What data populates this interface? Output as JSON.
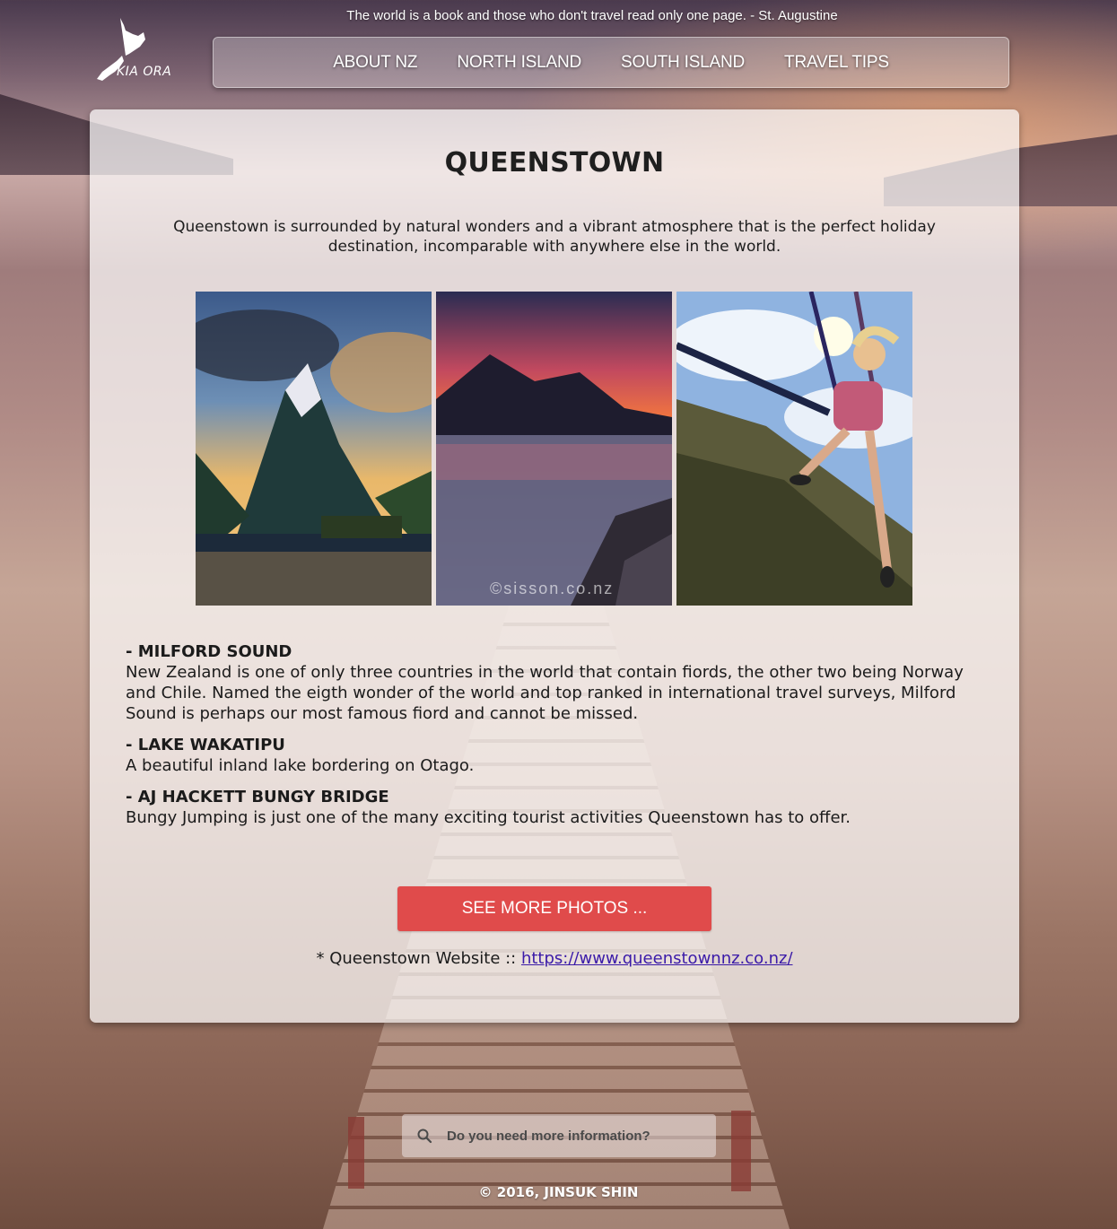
{
  "header": {
    "quote": "The world is a book and those who don't travel read only one page.  - St. Augustine",
    "logo_text": "KIA ORA"
  },
  "nav": {
    "items": [
      {
        "label": "ABOUT NZ"
      },
      {
        "label": "NORTH ISLAND"
      },
      {
        "label": "SOUTH ISLAND"
      },
      {
        "label": "TRAVEL TIPS"
      }
    ]
  },
  "main": {
    "title": "QUEENSTOWN",
    "intro": "Queenstown is surrounded by natural wonders and a vibrant atmosphere that is the perfect holiday destination, incomparable with anywhere else in the world.",
    "photo_watermark": "©sisson.co.nz",
    "sections": [
      {
        "heading": "- MILFORD SOUND",
        "body": "New Zealand is one of only three countries in the world that contain fiords, the other two being Norway and Chile. Named the eigth wonder of the world and top ranked in international travel surveys, Milford Sound is perhaps our most famous fiord and cannot be missed."
      },
      {
        "heading": "- LAKE WAKATIPU",
        "body": "A beautiful inland lake bordering on Otago."
      },
      {
        "heading": "- AJ HACKETT BUNGY BRIDGE",
        "body": "Bungy Jumping is just one of the many exciting tourist activities Queenstown has to offer."
      }
    ],
    "button_label": "SEE MORE PHOTOS ...",
    "website_prefix": "* Queenstown Website :: ",
    "website_link": "https://www.queenstownnz.co.nz/"
  },
  "search": {
    "placeholder": "Do you need more information?"
  },
  "footer": {
    "copyright": "© 2016, JINSUK SHIN"
  },
  "colors": {
    "button": "#e04b4b",
    "link": "#3a1aa8"
  }
}
